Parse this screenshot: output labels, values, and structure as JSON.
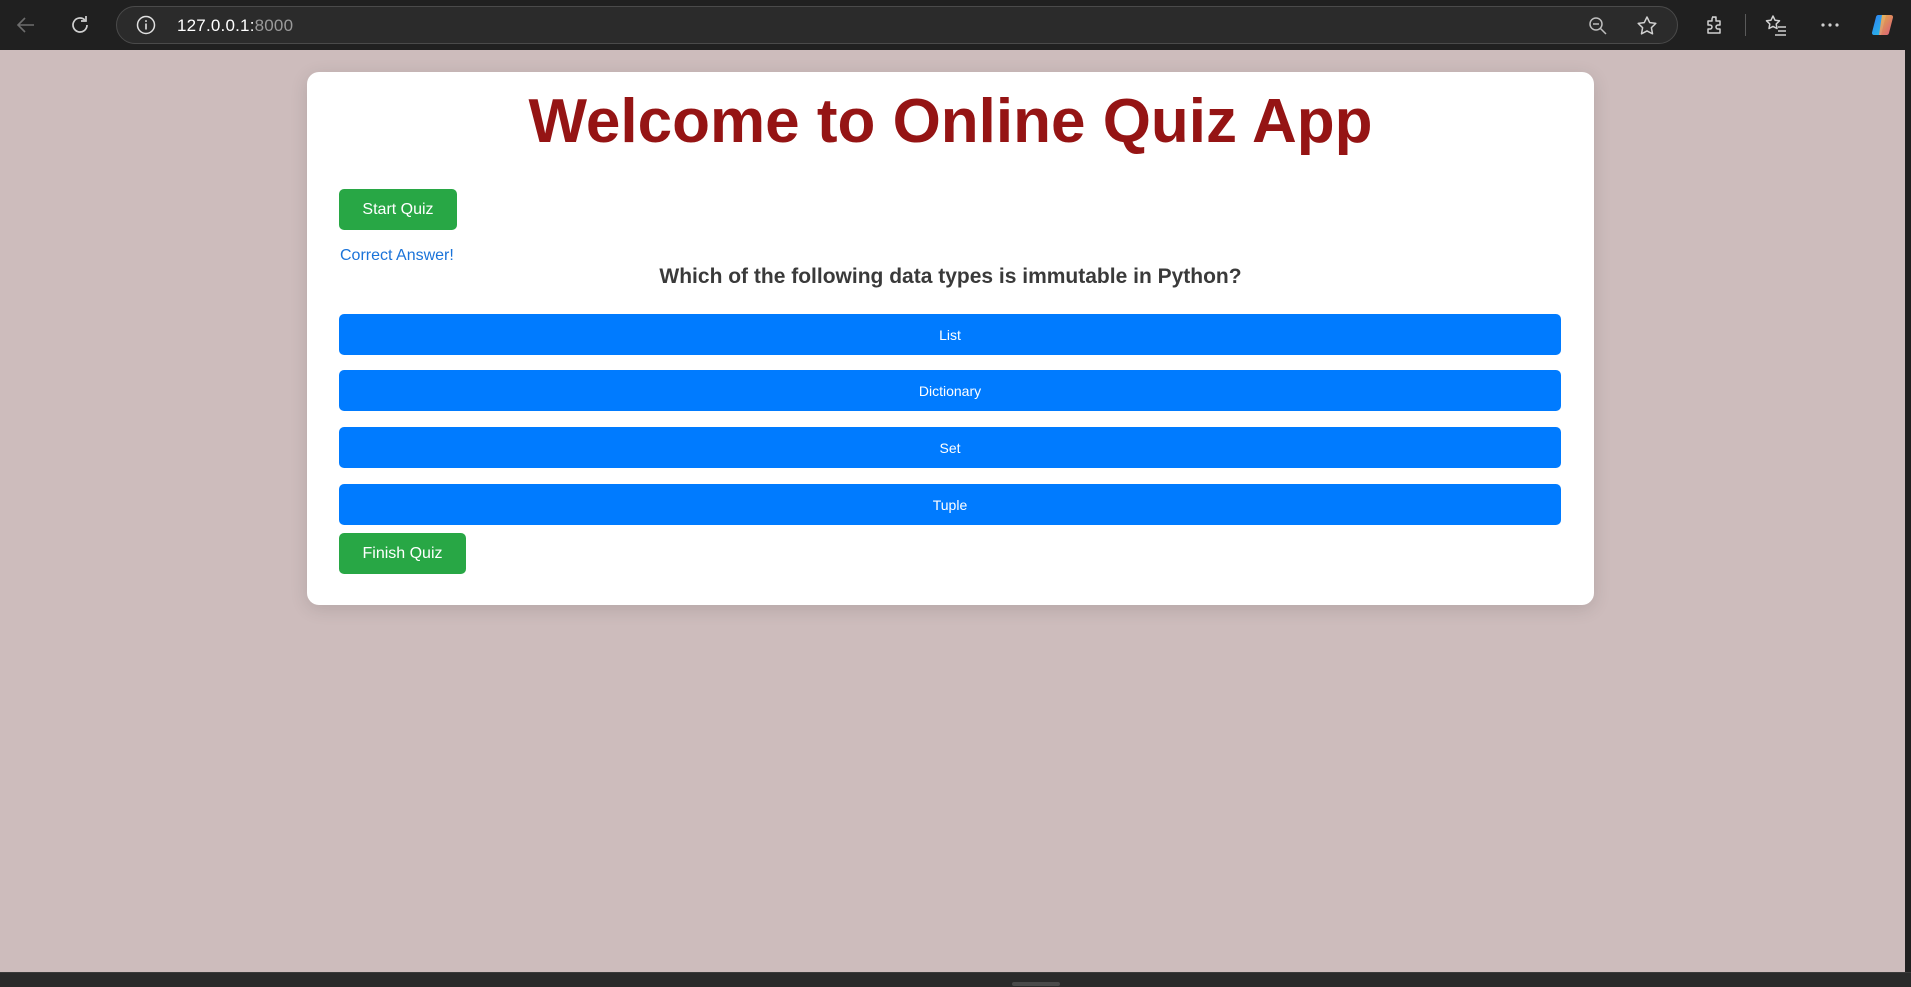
{
  "browser": {
    "url_host": "127.0.0.1:",
    "url_port": "8000",
    "icons": [
      "back-arrow-icon",
      "reload-icon",
      "info-icon",
      "zoom-out-icon",
      "favorite-star-icon",
      "extensions-icon",
      "favorites-icon",
      "more-icon",
      "copilot-icon"
    ]
  },
  "app": {
    "title": "Welcome to Online Quiz App",
    "start_label": "Start Quiz",
    "feedback": "Correct Answer!",
    "question": "Which of the following data types is immutable in Python?",
    "options": [
      "List",
      "Dictionary",
      "Set",
      "Tuple"
    ],
    "finish_label": "Finish Quiz"
  },
  "colors": {
    "page_bg": "#cdbcbc",
    "title": "#951414",
    "green_button": "#28a745",
    "option_button": "#007bff",
    "feedback_text": "#1a73d9"
  }
}
